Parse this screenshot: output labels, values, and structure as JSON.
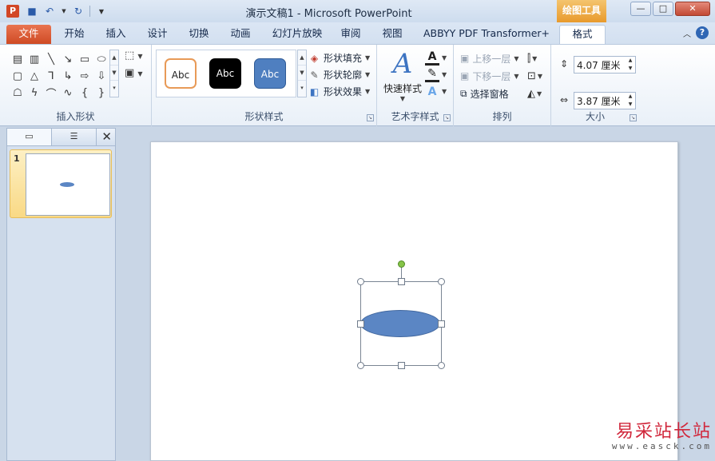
{
  "window": {
    "title": "演示文稿1 - Microsoft PowerPoint",
    "context_tab_group": "绘图工具",
    "app_icon_letter": "P",
    "controls": {
      "minimize": "—",
      "maximize": "□",
      "close": "✕"
    }
  },
  "tabs": [
    "文件",
    "开始",
    "插入",
    "设计",
    "切换",
    "动画",
    "幻灯片放映",
    "审阅",
    "视图",
    "ABBYY PDF Transformer+",
    "格式"
  ],
  "active_tab": "格式",
  "ribbon": {
    "insert_shapes": {
      "label": "插入形状"
    },
    "shape_styles": {
      "label": "形状样式",
      "samples": [
        "Abc",
        "Abc",
        "Abc"
      ],
      "fill": "形状填充",
      "outline": "形状轮廓",
      "effects": "形状效果"
    },
    "wordart": {
      "label": "艺术字样式",
      "quick_styles": "快速样式"
    },
    "arrange": {
      "label": "排列",
      "bring_forward": "上移一层",
      "send_backward": "下移一层",
      "selection_pane": "选择窗格"
    },
    "size": {
      "label": "大小",
      "height": "4.07 厘米",
      "width": "3.87 厘米"
    }
  },
  "slides_pane": {
    "slide_number": "1"
  },
  "watermark": {
    "cn": "易采站长站",
    "url": "www.easck.com"
  },
  "colors": {
    "shape_fill": "#5b86c4",
    "rotation_handle": "#86c448",
    "file_tab": "#d24726",
    "context_tools": "#e89a2c"
  }
}
